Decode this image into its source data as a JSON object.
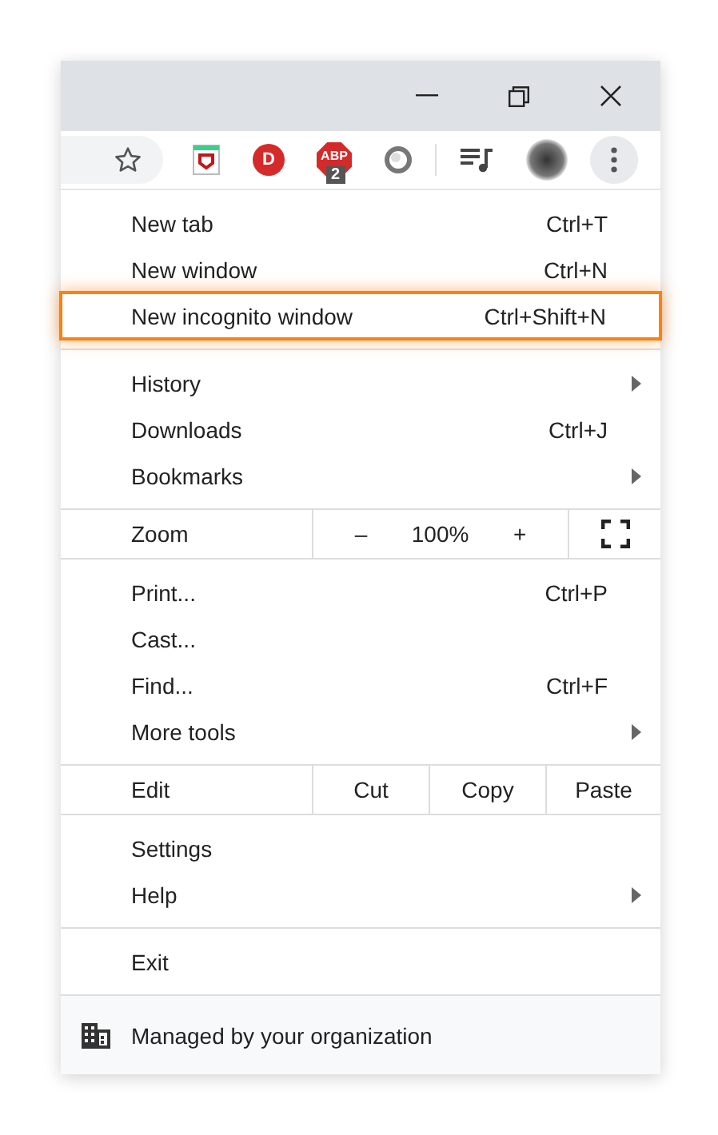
{
  "toolbar": {
    "extensions": [
      {
        "kind": "shield"
      },
      {
        "kind": "letter",
        "label": "D"
      },
      {
        "kind": "stop",
        "label": "ABP",
        "badge": "2"
      },
      {
        "kind": "ring"
      }
    ]
  },
  "menu": {
    "sections": [
      {
        "rows": [
          {
            "kind": "item",
            "label": "New tab",
            "shortcut": "Ctrl+T",
            "submenu": false,
            "highlighted": false
          },
          {
            "kind": "item",
            "label": "New window",
            "shortcut": "Ctrl+N",
            "submenu": false,
            "highlighted": false
          },
          {
            "kind": "item",
            "label": "New incognito window",
            "shortcut": "Ctrl+Shift+N",
            "submenu": false,
            "highlighted": true
          }
        ]
      },
      {
        "rows": [
          {
            "kind": "item",
            "label": "History",
            "submenu": true,
            "highlighted": false
          },
          {
            "kind": "item",
            "label": "Downloads",
            "shortcut": "Ctrl+J",
            "submenu": false,
            "highlighted": false
          },
          {
            "kind": "item",
            "label": "Bookmarks",
            "submenu": true,
            "highlighted": false
          }
        ]
      },
      {
        "rows": [
          {
            "kind": "zoom",
            "label": "Zoom",
            "minus": "–",
            "value": "100%",
            "plus": "+"
          }
        ]
      },
      {
        "rows": [
          {
            "kind": "item",
            "label": "Print...",
            "shortcut": "Ctrl+P",
            "submenu": false,
            "highlighted": false
          },
          {
            "kind": "item",
            "label": "Cast...",
            "submenu": false,
            "highlighted": false
          },
          {
            "kind": "item",
            "label": "Find...",
            "shortcut": "Ctrl+F",
            "submenu": false,
            "highlighted": false
          },
          {
            "kind": "item",
            "label": "More tools",
            "submenu": true,
            "highlighted": false
          }
        ]
      },
      {
        "rows": [
          {
            "kind": "edit",
            "label": "Edit",
            "buttons": [
              "Cut",
              "Copy",
              "Paste"
            ]
          }
        ]
      },
      {
        "rows": [
          {
            "kind": "item",
            "label": "Settings",
            "submenu": false,
            "highlighted": false
          },
          {
            "kind": "item",
            "label": "Help",
            "submenu": true,
            "highlighted": false
          }
        ]
      },
      {
        "rows": [
          {
            "kind": "item",
            "label": "Exit",
            "submenu": false,
            "highlighted": false
          }
        ]
      }
    ],
    "footer": {
      "text": "Managed by your organization"
    }
  }
}
